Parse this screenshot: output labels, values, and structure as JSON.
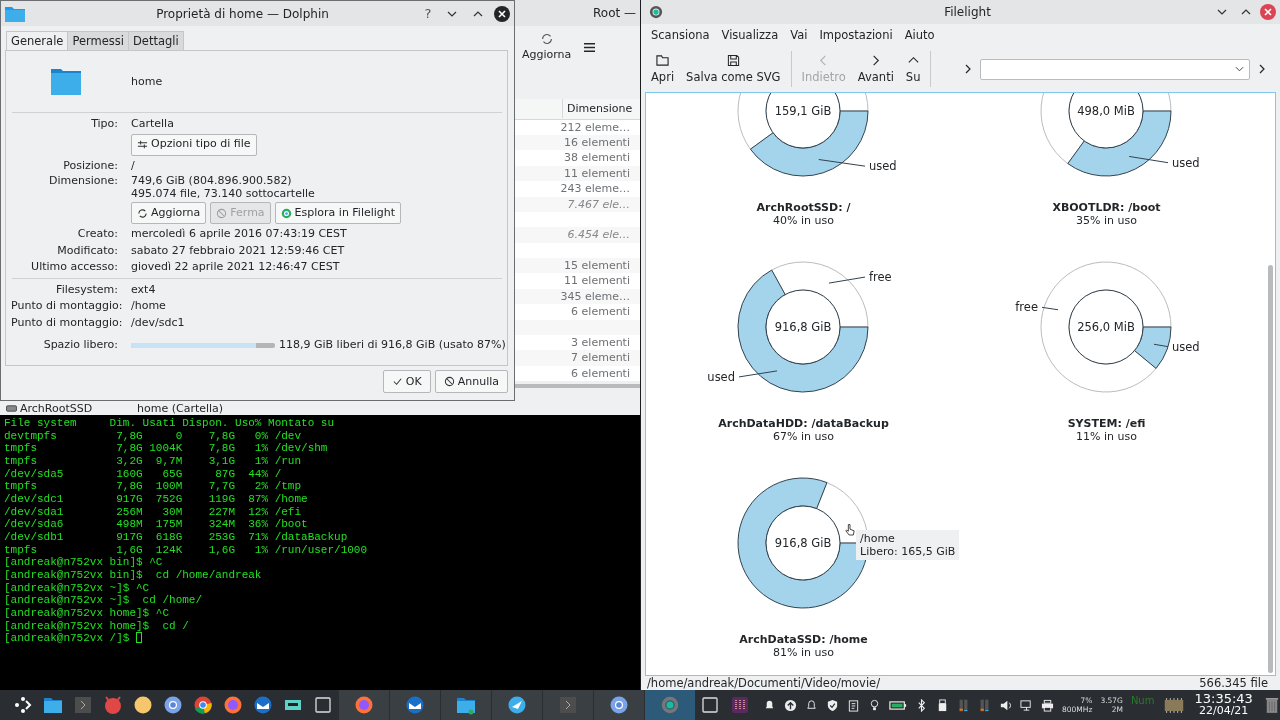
{
  "behind_window": {
    "title": "Root —",
    "refresh_button": "Aggiorna",
    "column": "Dimensione",
    "rows": [
      {
        "size": "212 eleme…",
        "italic": false
      },
      {
        "size": "16 elementi",
        "italic": false
      },
      {
        "size": "38 elementi",
        "italic": false
      },
      {
        "size": "11 elementi",
        "italic": false
      },
      {
        "size": "243 eleme…",
        "italic": false
      },
      {
        "size": "7.467 ele…",
        "italic": true
      },
      {},
      {
        "size": "6.454 ele…",
        "italic": true
      },
      {},
      {
        "size": "15 elementi",
        "italic": false
      },
      {
        "size": "11 elementi",
        "italic": false
      },
      {
        "size": "345 eleme…",
        "italic": false
      },
      {
        "size": "6 elementi",
        "italic": false
      },
      {},
      {
        "size": "3 elementi",
        "italic": false
      },
      {
        "size": "7 elementi",
        "italic": false
      },
      {
        "size": "6 elementi",
        "italic": false
      }
    ],
    "place": "ArchRootSSD",
    "status": "home (Cartella)"
  },
  "dialog": {
    "title": "Proprietà di home — Dolphin",
    "help": "?",
    "tabs": [
      {
        "label": "Generale",
        "selected": true
      },
      {
        "label": "Permessi",
        "selected": false
      },
      {
        "label": "Dettagli",
        "selected": false
      }
    ],
    "name": "home",
    "fields": [
      {
        "kind": "text",
        "label": "Tipo:",
        "value": "Cartella"
      },
      {
        "kind": "buttons",
        "buttons": [
          {
            "text": "Opzioni tipo di file",
            "disabled": false
          }
        ]
      },
      {
        "kind": "text",
        "label": "Posizione:",
        "value": "/"
      },
      {
        "kind": "lines",
        "label": "Dimensione:",
        "lines": [
          "749,6 GiB (804.896.900.582)",
          "495.074 file, 73.140 sottocartelle"
        ]
      },
      {
        "kind": "buttons",
        "buttons": [
          {
            "text": "Aggiorna",
            "disabled": false
          },
          {
            "text": "Ferma",
            "disabled": true
          },
          {
            "text": "Esplora in Filelight",
            "disabled": false
          }
        ]
      },
      {
        "kind": "text",
        "label": "Creato:",
        "value": "mercoledì 6 aprile 2016 07:43:19 CEST"
      },
      {
        "kind": "text",
        "label": "Modificato:",
        "value": "sabato 27 febbraio 2021 12:59:46 CET"
      },
      {
        "kind": "text",
        "label": "Ultimo accesso:",
        "value": "giovedì 22 aprile 2021 12:46:47 CEST"
      },
      {
        "kind": "separator"
      },
      {
        "kind": "text",
        "label": "Filesystem:",
        "value": "ext4"
      },
      {
        "kind": "text",
        "label": "Punto di montaggio:",
        "value": "/home"
      },
      {
        "kind": "text",
        "label": "Punto di montaggio:",
        "value": "/dev/sdc1"
      },
      {
        "kind": "meter",
        "label": "Spazio libero:",
        "level": 0.87,
        "value": "118,9 GiB liberi di 916,8 GiB (usato 87%)"
      }
    ],
    "buttons": [
      "OK",
      "Annulla"
    ]
  },
  "terminal": {
    "cursor": true,
    "lines": [
      "File system     Dim. Usati Dispon. Uso% Montato su",
      "devtmpfs         7,8G     0    7,8G   0% /dev",
      "tmpfs            7,8G 1004K    7,8G   1% /dev/shm",
      "tmpfs            3,2G  9,7M    3,1G   1% /run",
      "/dev/sda5        160G   65G     87G  44% /",
      "tmpfs            7,8G  100M    7,7G   2% /tmp",
      "/dev/sdc1        917G  752G    119G  87% /home",
      "/dev/sda1        256M   30M    227M  12% /efi",
      "/dev/sda6        498M  175M    324M  36% /boot",
      "/dev/sdb1        917G  618G    253G  71% /dataBackup",
      "tmpfs            1,6G  124K    1,6G   1% /run/user/1000",
      "[andreak@n752vx bin]$ ^C",
      "[andreak@n752vx bin]$  cd /home/andreak",
      "[andreak@n752vx ~]$ ^C",
      "[andreak@n752vx ~]$  cd /home/",
      "[andreak@n752vx home]$ ^C",
      "[andreak@n752vx home]$  cd /",
      "[andreak@n752vx /]$ "
    ]
  },
  "filelight": {
    "title": "Filelight",
    "menu": [
      "Scansiona",
      "Visualizza",
      "Vai",
      "Impostazioni",
      "Aiuto"
    ],
    "toolbar": [
      {
        "text": "Apri",
        "disabled": false
      },
      {
        "text": "Salva come SVG",
        "disabled": false
      },
      {
        "text": "Indietro",
        "disabled": true
      },
      {
        "text": "Avanti",
        "disabled": false
      },
      {
        "text": "Su",
        "disabled": false
      }
    ],
    "disks": [
      {
        "size": "159,1 GiB",
        "name": "ArchRootSSD: /",
        "usage": "40% in uso",
        "chart_data": {
          "type": "donut",
          "values": [
            40,
            60
          ]
        },
        "labels": [
          {
            "kind": "used",
            "text": "used"
          }
        ]
      },
      {
        "size": "498,0 MiB",
        "name": "XBOOTLDR: /boot",
        "usage": "35% in uso",
        "chart_data": {
          "type": "donut",
          "values": [
            35,
            65
          ]
        },
        "labels": [
          {
            "kind": "used",
            "text": "used"
          }
        ]
      },
      {
        "size": "916,8 GiB",
        "name": "ArchDataHDD: /dataBackup",
        "usage": "67% in uso",
        "chart_data": {
          "type": "donut",
          "values": [
            67,
            33
          ]
        },
        "labels": [
          {
            "kind": "free",
            "text": "free"
          },
          {
            "kind": "used",
            "text": "used"
          }
        ]
      },
      {
        "size": "256,0 MiB",
        "name": "SYSTEM: /efi",
        "usage": "11% in uso",
        "chart_data": {
          "type": "donut",
          "values": [
            11,
            89
          ]
        },
        "labels": [
          {
            "kind": "free",
            "text": "free"
          },
          {
            "kind": "used",
            "text": "used"
          }
        ]
      },
      {
        "size": "916,8 GiB",
        "name": "ArchDataSSD: /home",
        "usage": "81% in uso",
        "chart_data": {
          "type": "donut",
          "values": [
            81,
            19
          ]
        },
        "tooltip": [
          "/home",
          "Libero: 165,5 GiB"
        ]
      }
    ],
    "status_path": "/home/andreak/Documenti/Video/movie/",
    "status_count": "566.345 file"
  },
  "taskbar": {
    "tasks": [
      {
        "selected": false
      },
      {
        "selected": false
      },
      {
        "selected": false
      },
      {
        "selected": false
      },
      {
        "selected": false
      },
      {
        "selected": false
      },
      {
        "selected": true
      }
    ],
    "cpu": [
      "7%",
      "800MHz"
    ],
    "memory": [
      "3.57G",
      "2M"
    ],
    "numlock": "Num",
    "time": "13:35:43",
    "date": "22/04/21"
  }
}
